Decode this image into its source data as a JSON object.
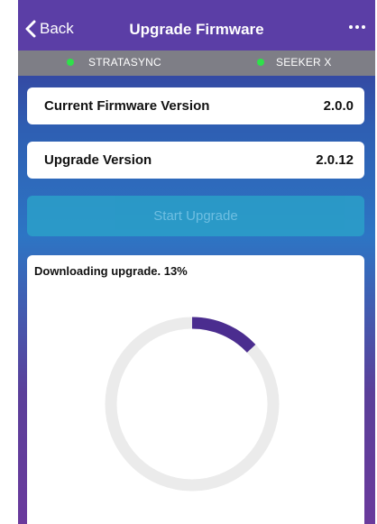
{
  "nav": {
    "back_label": "Back",
    "title": "Upgrade Firmware",
    "more_icon": "more-horizontal-icon"
  },
  "devices": [
    {
      "name": "STRATASYNC",
      "status_color": "#2fe04a"
    },
    {
      "name": "SEEKER X",
      "status_color": "#2fe04a"
    }
  ],
  "firmware": {
    "current_label": "Current Firmware Version",
    "current_value": "2.0.0",
    "upgrade_label": "Upgrade Version",
    "upgrade_value": "2.0.12"
  },
  "actions": {
    "start_upgrade_label": "Start Upgrade",
    "start_upgrade_enabled": false
  },
  "progress": {
    "status_text": "Downloading upgrade. 13%",
    "percent": 13,
    "track_color": "#ebebeb",
    "fill_color": "#4b2d8f"
  },
  "colors": {
    "navbar": "#5b3ea6",
    "device_bar": "#7e7e86",
    "button": "#2aa3c9"
  }
}
